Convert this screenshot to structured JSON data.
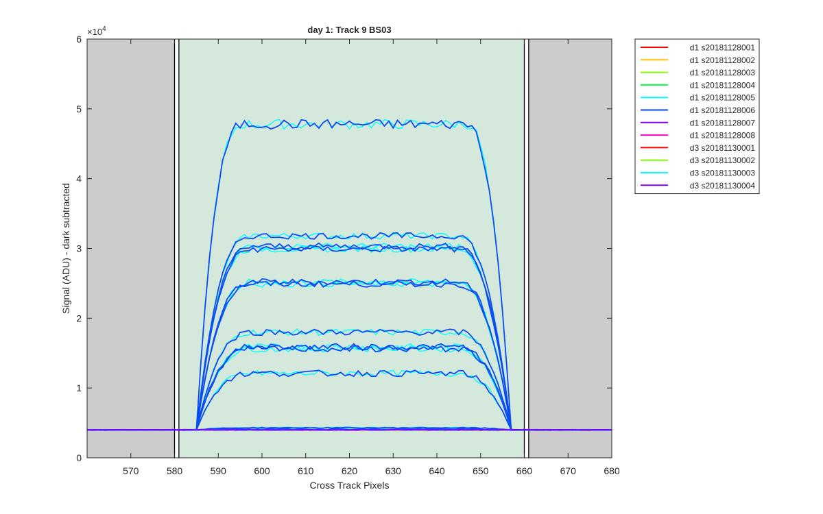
{
  "chart_data": {
    "type": "line",
    "title": "day 1: Track 9  BS03",
    "xlabel": "Cross Track Pixels",
    "ylabel": "Signal (ADU) - dark subtracted",
    "y_exponent_label": "×10",
    "y_exponent_power": "4",
    "xlim": [
      560,
      680
    ],
    "ylim": [
      0,
      60000
    ],
    "x_ticks": [
      570,
      580,
      590,
      600,
      610,
      620,
      630,
      640,
      650,
      660,
      670,
      680
    ],
    "y_ticks": [
      0,
      10000,
      20000,
      30000,
      40000,
      50000,
      60000
    ],
    "y_tick_labels": [
      "0",
      "1",
      "2",
      "3",
      "4",
      "5",
      "6"
    ],
    "grid": false,
    "legend_position": "outside-top-right",
    "shaded_regions": [
      {
        "x_start": 560,
        "x_end": 580,
        "color": "#cccccc"
      },
      {
        "x_start": 581,
        "x_end": 660,
        "color": "#d5e8dc"
      },
      {
        "x_start": 661,
        "x_end": 680,
        "color": "#cccccc"
      }
    ],
    "vertical_lines": [
      580,
      581,
      660,
      661
    ],
    "baseline": 4000,
    "edge_rise": [
      585,
      597
    ],
    "edge_fall": [
      645,
      657
    ],
    "plateau_levels": [
      47800,
      31800,
      30300,
      29900,
      25200,
      24900,
      18000,
      15900,
      15600,
      12100,
      4300,
      4100
    ],
    "series": [
      {
        "name": "d1 s20181128001",
        "color": "#ff0000"
      },
      {
        "name": "d1 s20181128002",
        "color": "#ffbf00"
      },
      {
        "name": "d1 s20181128003",
        "color": "#80ff00"
      },
      {
        "name": "d1 s20181128004",
        "color": "#00ff40"
      },
      {
        "name": "d1 s20181128005",
        "color": "#00ffff"
      },
      {
        "name": "d1 s20181128006",
        "color": "#0040ff"
      },
      {
        "name": "d1 s20181128007",
        "color": "#8000ff"
      },
      {
        "name": "d1 s20181128008",
        "color": "#ff00bf"
      },
      {
        "name": "d3 s20181130001",
        "color": "#ff0000"
      },
      {
        "name": "d3 s20181130002",
        "color": "#80ff00"
      },
      {
        "name": "d3 s20181130003",
        "color": "#00ffff"
      },
      {
        "name": "d3 s20181130004",
        "color": "#8000ff"
      }
    ]
  }
}
